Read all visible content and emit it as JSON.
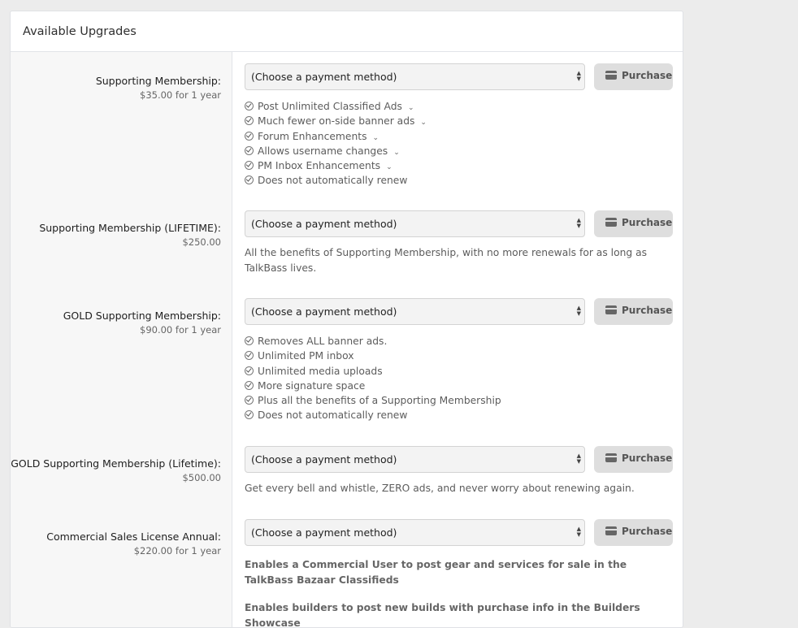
{
  "panel": {
    "title": "Available Upgrades"
  },
  "select_placeholder": "(Choose a payment method)",
  "purchase_label": "Purchase",
  "upgrades": [
    {
      "title": "Supporting Membership:",
      "price": "$35.00 for 1 year",
      "features": [
        {
          "text": "Post Unlimited Classified Ads",
          "expandable": true
        },
        {
          "text": "Much fewer on-side banner ads",
          "expandable": true
        },
        {
          "text": "Forum Enhancements",
          "expandable": true
        },
        {
          "text": "Allows username changes",
          "expandable": true
        },
        {
          "text": "PM Inbox Enhancements",
          "expandable": true
        },
        {
          "text": "Does not automatically renew",
          "expandable": false
        }
      ]
    },
    {
      "title": "Supporting Membership (LIFETIME):",
      "price": "$250.00",
      "description": "All the benefits of Supporting Membership, with no more renewals for as long as TalkBass lives."
    },
    {
      "title": "GOLD Supporting Membership:",
      "price": "$90.00 for 1 year",
      "features": [
        {
          "text": "Removes ALL banner ads."
        },
        {
          "text": "Unlimited PM inbox"
        },
        {
          "text": "Unlimited media uploads"
        },
        {
          "text": "More signature space"
        },
        {
          "text": "Plus all the benefits of a Supporting Membership"
        },
        {
          "text": "Does not automatically renew"
        }
      ]
    },
    {
      "title": "GOLD Supporting Membership (Lifetime):",
      "price": "$500.00",
      "description": "Get every bell and whistle, ZERO ads, and never worry about renewing again."
    },
    {
      "title": "Commercial Sales License Annual:",
      "price": "$220.00 for 1 year",
      "description": "Enables a Commercial User to post gear and services for sale in the TalkBass Bazaar Classifieds",
      "description_2": "Enables builders to post new builds with purchase info in the Builders Showcase"
    }
  ]
}
